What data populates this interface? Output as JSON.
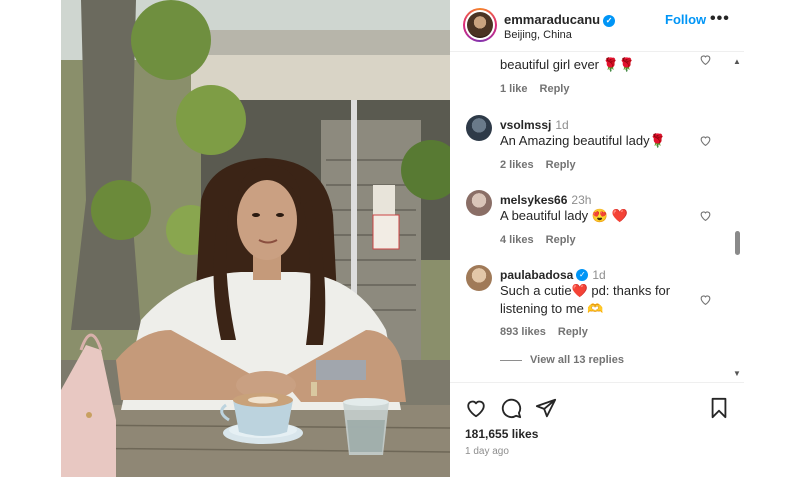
{
  "post": {
    "username": "emmaraducanu",
    "location": "Beijing, China",
    "follow_label": "Follow",
    "more_label": "•••",
    "verified": true
  },
  "comments": [
    {
      "user": "",
      "time": "",
      "text": "beautiful girl ever 🌹🌹",
      "likes": "1 like",
      "reply": "Reply"
    },
    {
      "user": "vsolmssj",
      "time": "1d",
      "text": "An Amazing beautiful lady🌹",
      "likes": "2 likes",
      "reply": "Reply"
    },
    {
      "user": "melsykes66",
      "time": "23h",
      "text": "A beautiful lady 😍 ❤️",
      "likes": "4 likes",
      "reply": "Reply"
    },
    {
      "user": "paulabadosa",
      "time": "1d",
      "verified": true,
      "text_line1": "Such a cutie❤️ pd: thanks for",
      "text_line2": "listening to me 🫶",
      "likes": "893 likes",
      "reply": "Reply"
    }
  ],
  "view_replies": "View all 13 replies",
  "likes_count": "181,655 likes",
  "posted_ago": "1 day ago",
  "icons": {
    "like": "heart-icon",
    "comment": "comment-icon",
    "share": "send-icon",
    "save": "bookmark-icon",
    "next": "chevron-right-icon"
  },
  "colors": {
    "accent": "#0095f6",
    "text": "#262626",
    "muted": "#8e8e8e"
  }
}
